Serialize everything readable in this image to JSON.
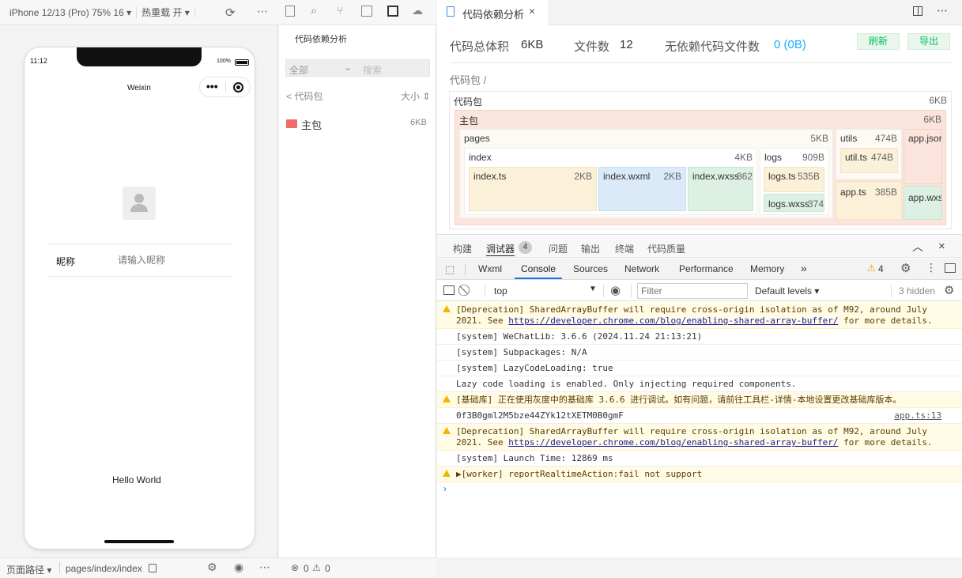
{
  "simulator": {
    "device": "iPhone 12/13 (Pro) 75% 16 ▾",
    "hot_reload": "热重载 开 ▾",
    "time": "11:12",
    "battery": "100%",
    "nav_title": "Weixin",
    "nickname_label": "昵称",
    "nickname_placeholder": "请输入昵称",
    "hello": "Hello World",
    "path_label": "页面路径 ▾",
    "path": "pages/index/index"
  },
  "tree": {
    "title": "代码依赖分析",
    "filter_all": "全部",
    "search_placeholder": "搜索",
    "back": "< 代码包",
    "sort": "大小 ⇕",
    "items": [
      {
        "name": "主包",
        "size": "6KB"
      }
    ],
    "errors": "0",
    "warnings": "0"
  },
  "analysis": {
    "tab_title": "代码依赖分析",
    "total_size_label": "代码总体积",
    "total_size": "6KB",
    "file_count_label": "文件数",
    "file_count": "12",
    "no_dep_label": "无依赖代码文件数",
    "no_dep_value": "0 (0B)",
    "refresh": "刷新",
    "export": "导出",
    "breadcrumb": "代码包 /",
    "treemap": {
      "root": {
        "name": "代码包",
        "size": "6KB"
      },
      "main": {
        "name": "主包",
        "size": "6KB"
      },
      "pages": {
        "name": "pages",
        "size": "5KB"
      },
      "index": {
        "name": "index",
        "size": "4KB"
      },
      "index_ts": {
        "name": "index.ts",
        "size": "2KB"
      },
      "index_wxml": {
        "name": "index.wxml",
        "size": "2KB"
      },
      "index_wxss": {
        "name": "index.wxss",
        "size": "862"
      },
      "logs": {
        "name": "logs",
        "size": "909B"
      },
      "logs_ts": {
        "name": "logs.ts",
        "size": "535B"
      },
      "logs_wxss": {
        "name": "logs.wxss",
        "size": "374"
      },
      "utils": {
        "name": "utils",
        "size": "474B"
      },
      "util_ts": {
        "name": "util.ts",
        "size": "474B"
      },
      "app_ts": {
        "name": "app.ts",
        "size": "385B"
      },
      "app_json": {
        "name": "app.jsor"
      },
      "app_wxss": {
        "name": "app.wxs"
      }
    }
  },
  "bottom_tabs": {
    "items": [
      "构建",
      "调试器",
      "问题",
      "输出",
      "终端",
      "代码质量"
    ],
    "debugger_badge": "4"
  },
  "devtools": {
    "tabs": [
      "Wxml",
      "Console",
      "Sources",
      "Network",
      "Performance",
      "Memory"
    ],
    "more": "»",
    "warning_count": "4",
    "context": "top",
    "filter_placeholder": "Filter",
    "levels": "Default levels ▾",
    "hidden": "3 hidden"
  },
  "console": [
    {
      "level": "warn",
      "text": "[Deprecation] SharedArrayBuffer will require cross-origin isolation as of M92, around July\n2021. See ",
      "link": "https://developer.chrome.com/blog/enabling-shared-array-buffer/",
      "tail": " for more details."
    },
    {
      "level": "info",
      "text": "[system] WeChatLib: 3.6.6 (2024.11.24 21:13:21)"
    },
    {
      "level": "info",
      "text": "[system] Subpackages: N/A"
    },
    {
      "level": "info",
      "text": "[system] LazyCodeLoading: true"
    },
    {
      "level": "info",
      "text": "Lazy code loading is enabled. Only injecting required components."
    },
    {
      "level": "warn",
      "text": "[基础库] 正在使用灰度中的基础库 3.6.6 进行调试。如有问题，请前往工具栏-详情-本地设置更改基础库版本。"
    },
    {
      "level": "info",
      "text": "0f3B0gml2M5bze44ZYk12tXETM0B0gmF",
      "source": "app.ts:13"
    },
    {
      "level": "warn",
      "text": "[Deprecation] SharedArrayBuffer will require cross-origin isolation as of M92, around July\n2021. See ",
      "link": "https://developer.chrome.com/blog/enabling-shared-array-buffer/",
      "tail": " for more details."
    },
    {
      "level": "info",
      "text": "[system] Launch Time: 12869 ms"
    },
    {
      "level": "warn",
      "text": "▶[worker] reportRealtimeAction:fail not support"
    }
  ],
  "colors": {
    "accent_green": "#07c160",
    "link_blue": "#1aad19",
    "value_blue": "#10aeff"
  }
}
